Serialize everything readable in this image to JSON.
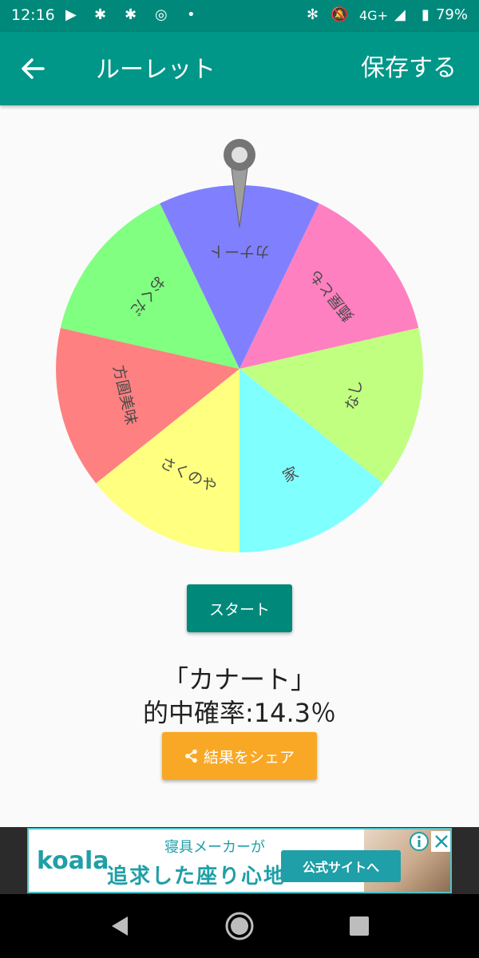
{
  "status_bar": {
    "time": "12:16",
    "network": "4G+",
    "battery": "79%"
  },
  "app_bar": {
    "title": "ルーレット",
    "save_label": "保存する"
  },
  "roulette": {
    "segments": [
      {
        "label": "カナート",
        "color": "#8080ff"
      },
      {
        "label": "麺屋とも",
        "color": "#ff80c0"
      },
      {
        "label": "なし",
        "color": "#c0ff80"
      },
      {
        "label": "家",
        "color": "#80ffff"
      },
      {
        "label": "さくのや",
        "color": "#ffff80"
      },
      {
        "label": "方圓美味",
        "color": "#ff8080"
      },
      {
        "label": "おくだ",
        "color": "#80ff80"
      }
    ]
  },
  "start_button": "スタート",
  "result": {
    "text": "「カナート」",
    "probability": "的中確率:14.3％"
  },
  "share_button": "結果をシェア",
  "ad": {
    "logo": "koala",
    "line1": "寝具メーカーが",
    "line2": "追求した座り心地",
    "cta": "公式サイトへ"
  },
  "colors": {
    "primary": "#009688",
    "primary_dark": "#00897b",
    "accent": "#f9a825"
  }
}
